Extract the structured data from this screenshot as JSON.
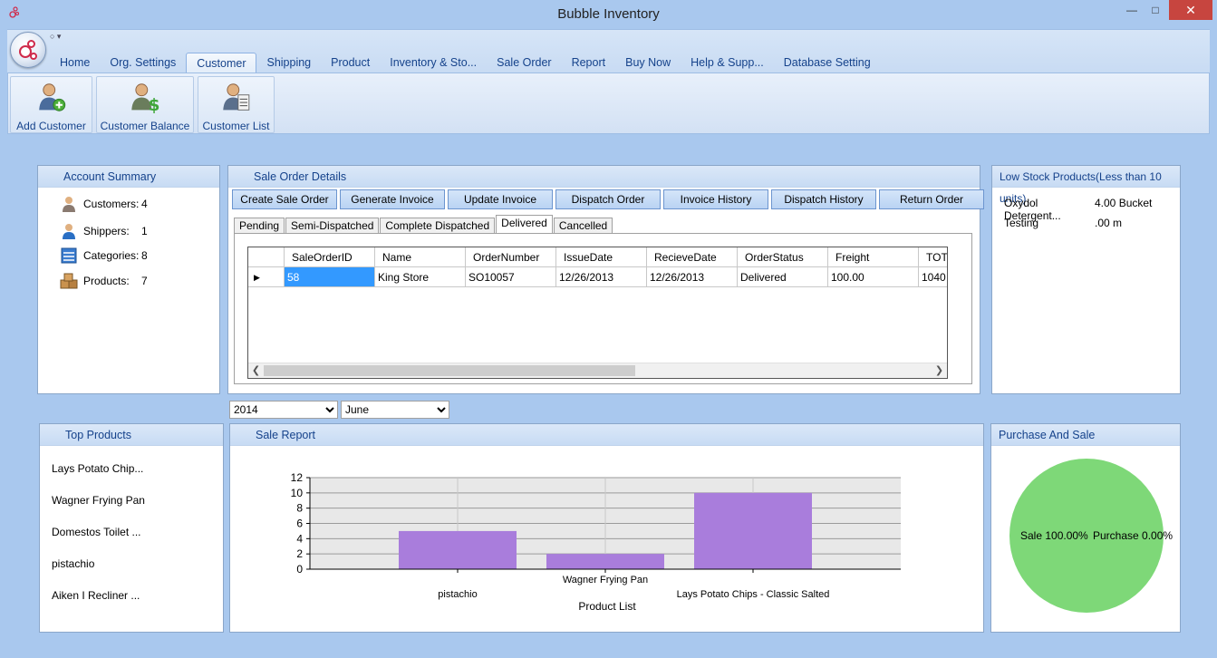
{
  "window": {
    "title": "Bubble Inventory",
    "minimize": "—",
    "maximize": "□",
    "close": "✕"
  },
  "qat": "○ ▾",
  "ribbon": {
    "tabs": [
      "Home",
      "Org. Settings",
      "Customer",
      "Shipping",
      "Product",
      "Inventory & Sto...",
      "Sale Order",
      "Report",
      "Buy Now",
      "Help & Supp...",
      "Database Setting"
    ],
    "active_tab": "Customer",
    "buttons": [
      {
        "label": "Add Customer",
        "icon": "add-user-icon"
      },
      {
        "label": "Customer Balance",
        "icon": "customer-balance-icon"
      },
      {
        "label": "Customer List",
        "icon": "customer-list-icon"
      }
    ]
  },
  "account_summary": {
    "title": "Account Summary",
    "rows": [
      {
        "label": "Customers:",
        "value": "4",
        "icon": "customer-icon"
      },
      {
        "label": "Shippers:",
        "value": "1",
        "icon": "shipper-icon"
      },
      {
        "label": "Categories:",
        "value": "8",
        "icon": "categories-icon"
      },
      {
        "label": "Products:",
        "value": "7",
        "icon": "products-icon"
      }
    ]
  },
  "sale_order": {
    "title": "Sale Order Details",
    "buttons": [
      "Create Sale Order",
      "Generate Invoice",
      "Update Invoice",
      "Dispatch Order",
      "Invoice History",
      "Dispatch History",
      "Return Order"
    ],
    "tabs": [
      "Pending",
      "Semi-Dispatched",
      "Complete Dispatched",
      "Delivered",
      "Cancelled"
    ],
    "active_tab": "Delivered",
    "columns": [
      "SaleOrderID",
      "Name",
      "OrderNumber",
      "IssueDate",
      "RecieveDate",
      "OrderStatus",
      "Freight",
      "TOT"
    ],
    "rows": [
      [
        "58",
        "King Store",
        "SO10057",
        "12/26/2013",
        "12/26/2013",
        "Delivered",
        "100.00",
        "1040"
      ]
    ]
  },
  "low_stock": {
    "title": "Low Stock Products(Less than 10 units)",
    "items": [
      {
        "name": "Oxydol Detergent...",
        "qty": "4.00 Bucket"
      },
      {
        "name": "Testing",
        "qty": ".00 m"
      }
    ]
  },
  "filters": {
    "year": "2014",
    "month": "June"
  },
  "top_products": {
    "title": "Top Products",
    "items": [
      "Lays Potato Chip...",
      "Wagner Frying Pan",
      "Domestos Toilet ...",
      "pistachio",
      "Aiken I Recliner ..."
    ]
  },
  "sale_report": {
    "title": "Sale Report"
  },
  "purchase_sale": {
    "title": "Purchase And Sale",
    "sale_label": "Sale 100.00%",
    "purchase_label": "Purchase 0.00%",
    "color": "#7ed878"
  },
  "chart_data": {
    "type": "bar",
    "categories": [
      "pistachio",
      "Wagner Frying Pan",
      "Lays Potato Chips - Classic Salted"
    ],
    "values": [
      5,
      2,
      10
    ],
    "xlabel": "Product List",
    "ylabel": "",
    "ylim": [
      0,
      12
    ],
    "yticks": [
      0,
      2,
      4,
      6,
      8,
      10,
      12
    ],
    "bar_color": "#a97ddc",
    "grid": true
  }
}
